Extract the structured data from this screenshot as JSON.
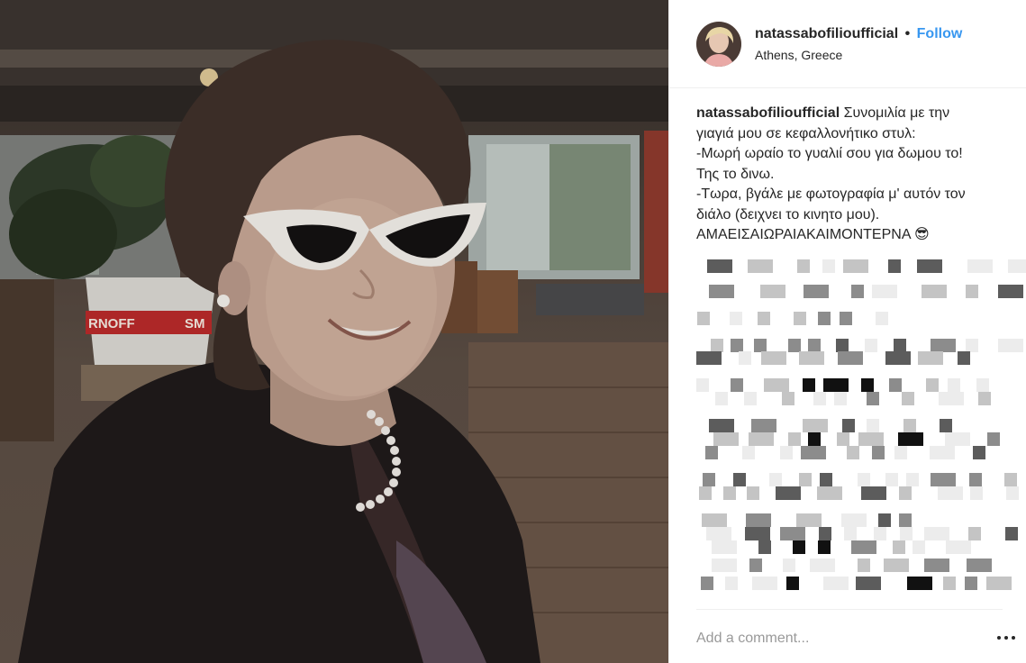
{
  "post": {
    "username": "natassabofilioufficial",
    "separator": "•",
    "follow_label": "Follow",
    "location": "Athens, Greece"
  },
  "caption": {
    "username": "natassabofilioufficial",
    "lines": [
      " Συνομιλία με την",
      "γιαγιά μου σε κεφαλλονήτικο στυλ:",
      "-Μωρή ωραίο το γυαλιί σου για δωμου το!",
      "Της το δινω.",
      "-Τωρα, βγάλε με φωτογραφία μ' αυτόν τον",
      "διάλο (δειχνει το κινητο μου).",
      "ΑΜΑΕΙΣΑΙΩΡΑΙΑΚΑΙΜΟΝΤΕΡΝΑ 😎"
    ]
  },
  "photo": {
    "sign_text_1": "RNOFF",
    "sign_text_2": "SM"
  },
  "add_comment": {
    "placeholder": "Add a comment..."
  },
  "icons": {
    "more": "more-options-icon",
    "avatar": "profile-avatar"
  }
}
